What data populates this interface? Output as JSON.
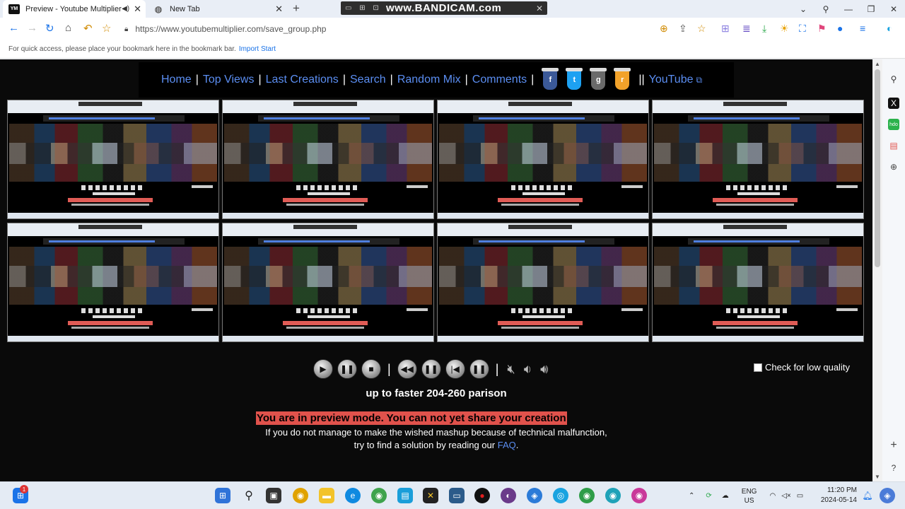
{
  "browser": {
    "tabs": [
      {
        "title": "Preview - Youtube Multiplier",
        "favicon": "YM"
      },
      {
        "title": "New Tab"
      }
    ],
    "recorder_watermark": "www.BANDICAM.com",
    "url": "https://www.youtubemultiplier.com/save_group.php",
    "bookmark_hint": "For quick access, please place your bookmark here in the bookmark bar.",
    "bookmark_import": "Import Start"
  },
  "site": {
    "nav": [
      "Home",
      "Top Views",
      "Last Creations",
      "Search",
      "Random Mix",
      "Comments"
    ],
    "social": [
      {
        "name": "facebook",
        "glyph": "f",
        "color": "#3b5998"
      },
      {
        "name": "twitter",
        "glyph": "t",
        "color": "#1da1f2"
      },
      {
        "name": "google",
        "glyph": "g",
        "color": "#6a6a6a"
      },
      {
        "name": "rss",
        "glyph": "r",
        "color": "#f2a22a"
      }
    ],
    "youtube_link": "YouTube",
    "low_quality_label": "Check for low quality",
    "speed_text": "up to faster 204-260 parison",
    "preview_warning": "You are in preview mode. You can not yet share your creation",
    "help_line1": "If you do not manage to make the wished mashup because of technical malfunction,",
    "help_line2_prefix": "try to find a solution by reading our",
    "help_faq": "FAQ",
    "help_line2_suffix": "."
  },
  "player_controls": [
    "play",
    "pause",
    "stop",
    "rewind",
    "pause-all",
    "previous",
    "pause-secondary",
    "mute",
    "volume-down",
    "volume-up"
  ],
  "taskbar": {
    "language": "ENG",
    "region": "US",
    "time": "11:20 PM",
    "date": "2024-05-14",
    "notification_badge": "1"
  },
  "colors": {
    "page_background": "#0a0a0a",
    "link": "#5b8ef2",
    "warning_background": "#e0524c"
  }
}
